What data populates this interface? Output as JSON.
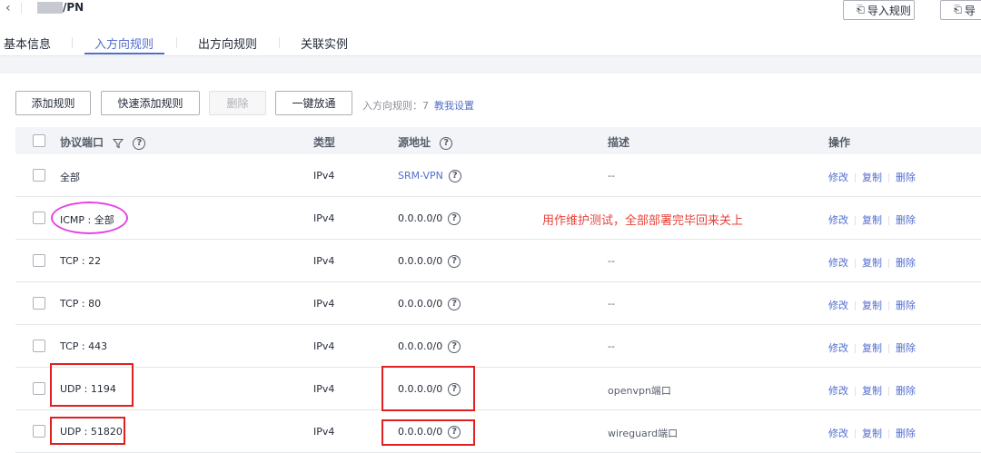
{
  "header": {
    "back_icon": "chevron-left-icon",
    "title": "/PN",
    "import_button": "导入规则",
    "export_button": "导"
  },
  "tabs": [
    {
      "label": "基本信息"
    },
    {
      "label": "入方向规则",
      "active": true
    },
    {
      "label": "出方向规则"
    },
    {
      "label": "关联实例"
    }
  ],
  "toolbar": {
    "add_rule": "添加规则",
    "quick_add_rule": "快速添加规则",
    "delete": "删除",
    "one_click_open": "一键放通",
    "rule_count_label": "入方向规则：7",
    "help_link": "教我设置"
  },
  "table": {
    "headers": {
      "protocol_port": "协议端口",
      "type": "类型",
      "source": "源地址",
      "description": "描述",
      "operations": "操作"
    },
    "rows": [
      {
        "protocol_port": "全部",
        "type": "IPv4",
        "source": "SRM-VPN",
        "description": "--"
      },
      {
        "protocol_port": "ICMP : 全部",
        "type": "IPv4",
        "source": "0.0.0.0/0",
        "description": ""
      },
      {
        "protocol_port": "TCP : 22",
        "type": "IPv4",
        "source": "0.0.0.0/0",
        "description": "--"
      },
      {
        "protocol_port": "TCP : 80",
        "type": "IPv4",
        "source": "0.0.0.0/0",
        "description": "--"
      },
      {
        "protocol_port": "TCP : 443",
        "type": "IPv4",
        "source": "0.0.0.0/0",
        "description": "--"
      },
      {
        "protocol_port": "UDP : 1194",
        "type": "IPv4",
        "source": "0.0.0.0/0",
        "description": "openvpn端口"
      },
      {
        "protocol_port": "UDP : 51820",
        "type": "IPv4",
        "source": "0.0.0.0/0",
        "description": "wireguard端口"
      }
    ],
    "actions": {
      "modify": "修改",
      "copy": "复制",
      "delete": "删除"
    }
  },
  "annotation": {
    "text": "用作维护测试，全部部署完毕回来关上",
    "ellipse_color": "#e542e5",
    "box_color": "#e02020"
  },
  "colors": {
    "accent": "#526ecc",
    "annotation_text": "#e8423a"
  }
}
